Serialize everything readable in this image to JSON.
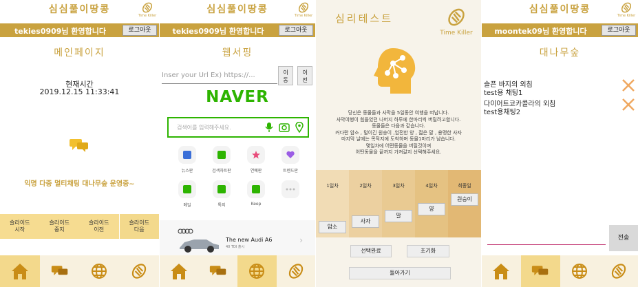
{
  "app": {
    "title": "심심풀이땅콩",
    "brand": "Time Killer",
    "accent": "#c9a23f"
  },
  "panel1": {
    "user_greeting": "tekies0909님 환영합니다",
    "logout": "로그아웃",
    "page_title": "메인페이지",
    "time_label": "현재시간",
    "time_value": "2019.12.15 11:33:41",
    "slogan": "익명 다중 멀티채팅 대나무숲 운영중~",
    "slide_buttons": [
      {
        "l1": "슬라이드",
        "l2": "시작"
      },
      {
        "l1": "슬라이드",
        "l2": "중지"
      },
      {
        "l1": "슬라이드",
        "l2": "이전"
      },
      {
        "l1": "슬라이드",
        "l2": "다음"
      }
    ]
  },
  "panel2": {
    "user_greeting": "tekies0909님 환영합니다",
    "logout": "로그아웃",
    "page_title": "웹서핑",
    "url_placeholder": "Inser your Url Ex) https://...",
    "move_button": {
      "l1": "이",
      "l2": "동"
    },
    "back_button": {
      "l1": "이",
      "l2": "전"
    },
    "naver_logo": "NAVER",
    "search_placeholder": "검색어를 입력해주세요.",
    "services_row1": [
      "뉴스판",
      "검색차트판",
      "연예판",
      "트렌드판"
    ],
    "services_row2": [
      "메일",
      "톡지",
      "Keep",
      ""
    ],
    "ad_title": "The new Audi A6",
    "ad_sub": "40 TDI 출시"
  },
  "panel3": {
    "title": "심리테스트",
    "brand": "Time Killer",
    "story": [
      "당신은 동물들과 사막을 5일동안 여행을 떠납니다.",
      "사막여행이 힘들었던 나머지 하루에 한마리씩 버릴려고합니다.",
      "동물들은 다음과 같습니다.",
      "커다란 암소 , 털이긴 원숭이 ,엄전한 양 , 젊은 말 , 용맹한 사자",
      "마지막 날에는 목적지에 도착하며 동물1마리가 남습니다.",
      "몇일차에 어떤동물을 버릴것이며",
      "어떤동물을 끝까지 가져갈지 선택해주세요."
    ],
    "days": [
      "1일차",
      "2일차",
      "3일차",
      "4일차",
      "최종일"
    ],
    "animals": [
      "암소",
      "사자",
      "말",
      "양",
      "원숭이"
    ],
    "select_done": "선택완료",
    "reset": "초기화",
    "go_back": "돌아가기"
  },
  "panel4": {
    "user_greeting": "moontek09님 환영합니다",
    "logout": "로그아웃",
    "page_title": "대나무숲",
    "posts": [
      {
        "title": "슬픈 바지의 외침",
        "room": "test용 채팅1"
      },
      {
        "title": "다이어트코카콜라의 외침",
        "room": "test용채팅2"
      }
    ],
    "send": "전송"
  }
}
